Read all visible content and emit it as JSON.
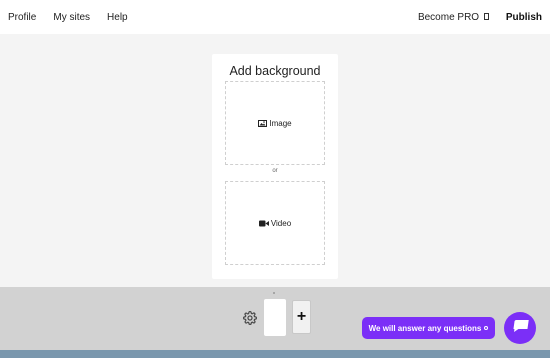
{
  "nav": {
    "profile": "Profile",
    "my_sites": "My sites",
    "help": "Help",
    "become_pro": "Become PRO",
    "publish": "Publish"
  },
  "card": {
    "title": "Add background",
    "image_label": "Image",
    "or_label": "or",
    "video_label": "Video"
  },
  "bottom": {
    "add_page": "+",
    "chat_text": "We will answer any questions"
  },
  "colors": {
    "accent": "#7b2ff7",
    "bottom_strip": "#7a97ad"
  },
  "icons": [
    "image-icon",
    "video-icon",
    "gear-icon",
    "chat-bubble-icon"
  ]
}
